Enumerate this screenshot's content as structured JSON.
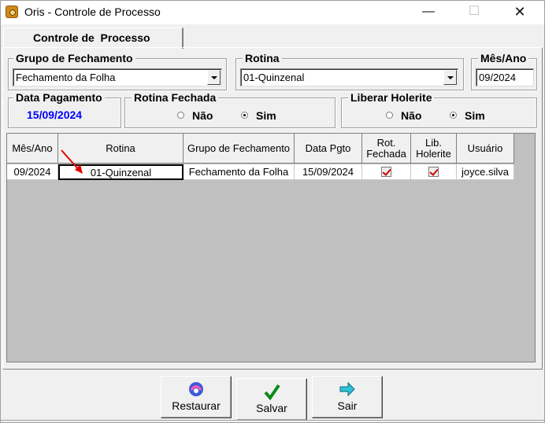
{
  "window": {
    "title": "Oris - Controle de Processo"
  },
  "tab": {
    "label": "Controle de  Processo"
  },
  "grupo": {
    "label": "Grupo de Fechamento",
    "value": "Fechamento da Folha"
  },
  "rotina": {
    "label": "Rotina",
    "value": "01-Quinzenal"
  },
  "mesano": {
    "label": "Mês/Ano",
    "value": "09/2024"
  },
  "data_pagamento": {
    "label": "Data Pagamento",
    "value": "15/09/2024",
    "color": "#0000ff"
  },
  "rotina_fechada": {
    "label": "Rotina Fechada",
    "nao": "Não",
    "sim": "Sim",
    "selected": "Sim"
  },
  "liberar_holerite": {
    "label": "Liberar Holerite",
    "nao": "Não",
    "sim": "Sim",
    "selected": "Sim"
  },
  "grid": {
    "headers": [
      "Mês/Ano",
      "Rotina",
      "Grupo de Fechamento",
      "Data Pgto",
      "Rot.\nFechada",
      "Lib.\nHolerite",
      "Usuário"
    ],
    "rows": [
      {
        "mesano": "09/2024",
        "rotina": "01-Quinzenal",
        "grupo": "Fechamento da Folha",
        "data_pgto": "15/09/2024",
        "rot_fechada": true,
        "lib_holerite": true,
        "usuario": "joyce.silva"
      }
    ]
  },
  "buttons": {
    "restaurar": "Restaurar",
    "salvar": "Salvar",
    "sair": "Sair"
  },
  "icons": {
    "app": "app-icon",
    "restaurar": "restore-icon",
    "salvar": "checkmark-icon",
    "sair": "exit-arrow-icon",
    "annotation": "red-arrow-icon"
  }
}
